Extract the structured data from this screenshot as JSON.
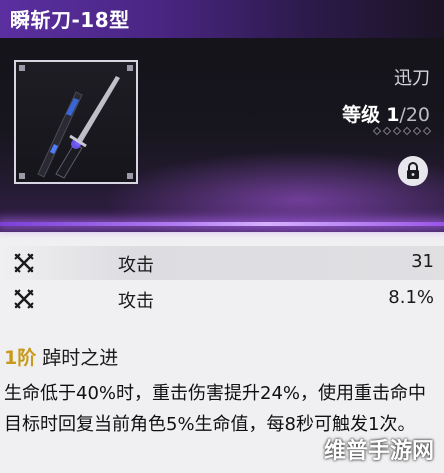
{
  "weapon": {
    "name": "瞬斩刀-18型",
    "type": "迅刀",
    "level_label": "等级",
    "level_current": "1",
    "level_max": "/20",
    "refine_slots": 6
  },
  "stats": [
    {
      "name": "攻击",
      "value": "31"
    },
    {
      "name": "攻击",
      "value": "8.1%"
    }
  ],
  "passive": {
    "tier": "1阶",
    "name": "踔时之进",
    "description": "生命低于40%时，重击伤害提升24%，使用重击命中目标时回复当前角色5%生命值，每8秒可触发1次。"
  },
  "watermark": "维普手游网",
  "colors": {
    "title_bar": "#5b2fa0",
    "accent_line": "#b17cf0",
    "tier_gold": "#c79a1c"
  },
  "icons": [
    "crossed-swords-icon",
    "lock-icon",
    "weapon-blade-image"
  ]
}
